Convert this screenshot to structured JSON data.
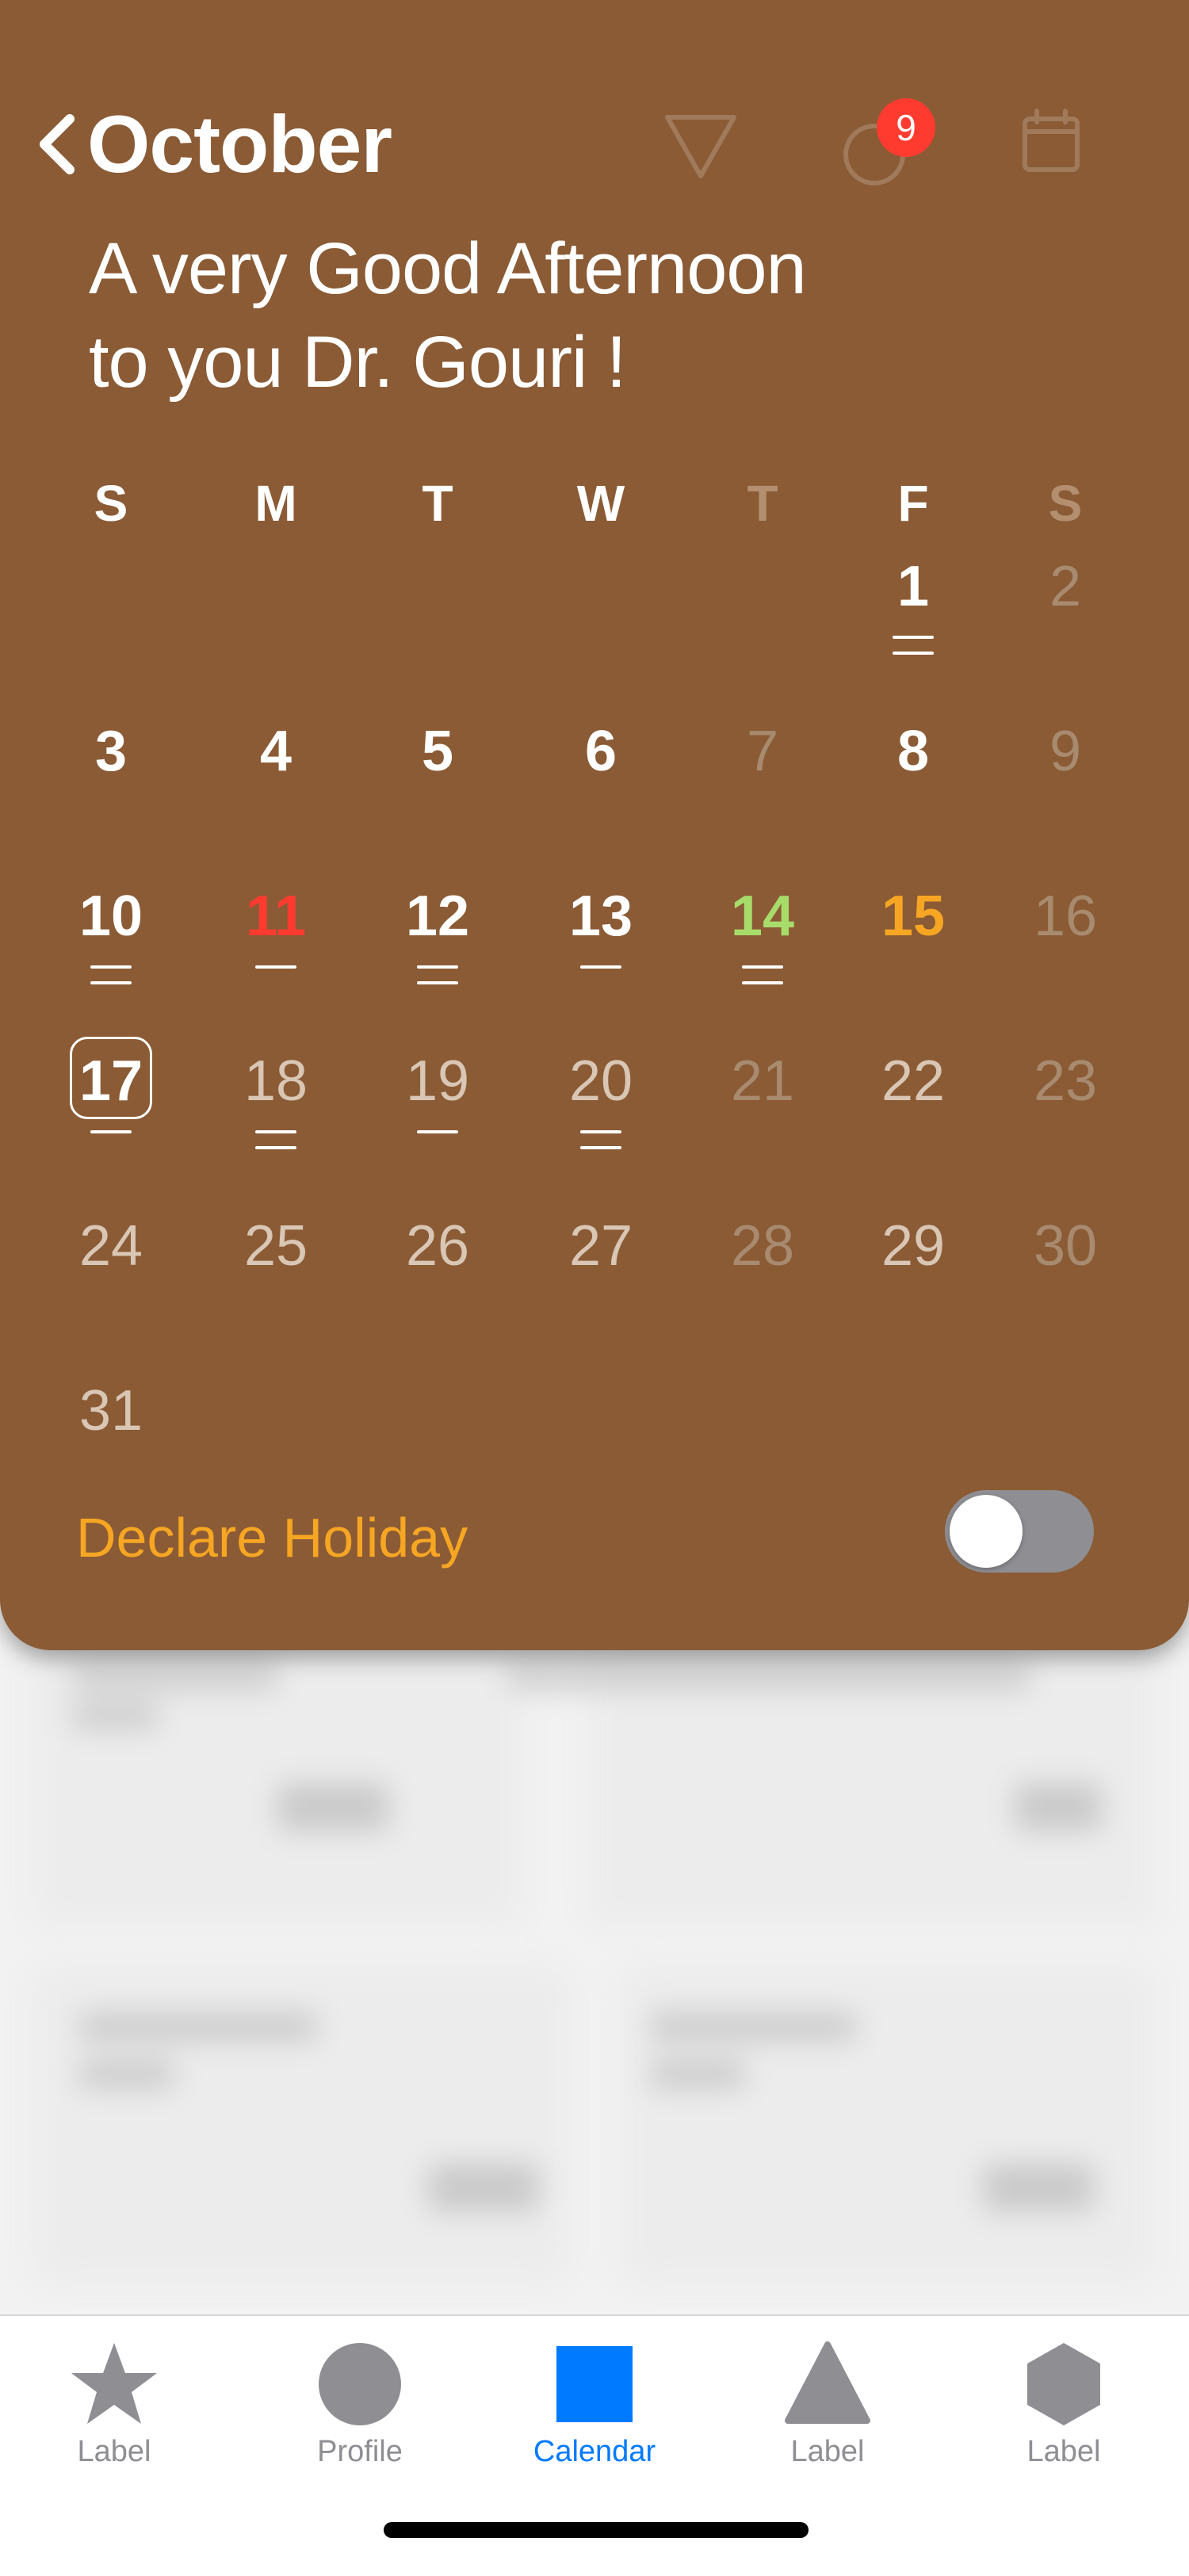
{
  "header": {
    "back_icon": "chevron-left-icon",
    "month": "October",
    "filter_icon": "filter-triangle-icon",
    "refresh_icon": "refresh-icon",
    "notification_count": "9",
    "calendar_icon": "calendar-icon"
  },
  "greeting": {
    "line1": "A very Good Afternoon",
    "line2": "to you Dr. Gouri !"
  },
  "calendar": {
    "weekdays": [
      "S",
      "M",
      "T",
      "W",
      "T",
      "F",
      "S"
    ],
    "days": [
      {
        "n": "1",
        "style": "bold",
        "marks": 2
      },
      {
        "n": "2",
        "style": "muted",
        "marks": 0
      },
      {
        "n": "3",
        "style": "bold",
        "marks": 0
      },
      {
        "n": "4",
        "style": "bold",
        "marks": 0
      },
      {
        "n": "5",
        "style": "bold",
        "marks": 0
      },
      {
        "n": "6",
        "style": "bold",
        "marks": 0
      },
      {
        "n": "7",
        "style": "muted",
        "marks": 0
      },
      {
        "n": "8",
        "style": "bold",
        "marks": 0
      },
      {
        "n": "9",
        "style": "muted",
        "marks": 0
      },
      {
        "n": "10",
        "style": "bold",
        "marks": 2
      },
      {
        "n": "11",
        "style": "red",
        "marks": 1
      },
      {
        "n": "12",
        "style": "bold",
        "marks": 2
      },
      {
        "n": "13",
        "style": "bold",
        "marks": 1
      },
      {
        "n": "14",
        "style": "green",
        "marks": 2
      },
      {
        "n": "15",
        "style": "orange",
        "marks": 0
      },
      {
        "n": "16",
        "style": "muted",
        "marks": 0
      },
      {
        "n": "17",
        "style": "today",
        "marks": 1
      },
      {
        "n": "18",
        "style": "light",
        "marks": 2
      },
      {
        "n": "19",
        "style": "light",
        "marks": 1
      },
      {
        "n": "20",
        "style": "light",
        "marks": 2
      },
      {
        "n": "21",
        "style": "muted",
        "marks": 0
      },
      {
        "n": "22",
        "style": "light",
        "marks": 0
      },
      {
        "n": "23",
        "style": "muted",
        "marks": 0
      },
      {
        "n": "24",
        "style": "light",
        "marks": 0
      },
      {
        "n": "25",
        "style": "light",
        "marks": 0
      },
      {
        "n": "26",
        "style": "light",
        "marks": 0
      },
      {
        "n": "27",
        "style": "light",
        "marks": 0
      },
      {
        "n": "28",
        "style": "muted",
        "marks": 0
      },
      {
        "n": "29",
        "style": "light",
        "marks": 0
      },
      {
        "n": "30",
        "style": "muted",
        "marks": 0
      },
      {
        "n": "31",
        "style": "light",
        "marks": 0
      }
    ]
  },
  "holiday": {
    "label": "Declare Holiday",
    "enabled": false
  },
  "tabs": [
    {
      "label": "Label",
      "icon": "star-icon",
      "active": false
    },
    {
      "label": "Profile",
      "icon": "circle-icon",
      "active": false
    },
    {
      "label": "Calendar",
      "icon": "square-icon",
      "active": true
    },
    {
      "label": "Label",
      "icon": "triangle-icon",
      "active": false
    },
    {
      "label": "Label",
      "icon": "hexagon-icon",
      "active": false
    }
  ],
  "colors": {
    "sheet": "#8a5b35",
    "accent": "#f6a623",
    "badge": "#ff3b30",
    "active_tab": "#007aff"
  }
}
